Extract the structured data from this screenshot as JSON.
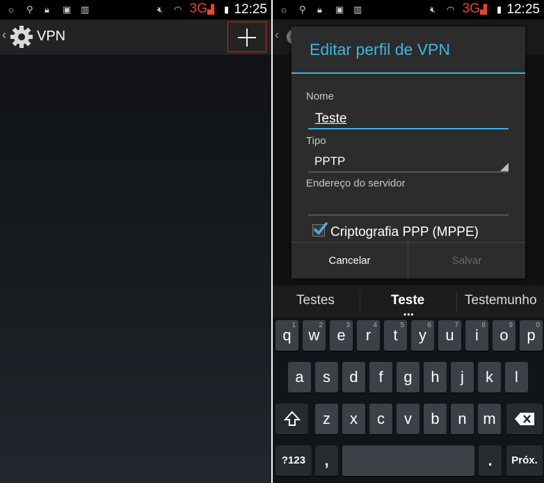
{
  "status": {
    "time": "12:25",
    "network": "3G"
  },
  "left": {
    "actionbar": {
      "title": "VPN"
    }
  },
  "dialog": {
    "title": "Editar perfil de VPN",
    "name_label": "Nome",
    "name_value": "Teste",
    "type_label": "Tipo",
    "type_value": "PPTP",
    "server_label": "Endereço do servidor",
    "server_value": "",
    "checkbox_label": "Criptografia PPP (MPPE)",
    "checkbox_checked": true,
    "cancel_label": "Cancelar",
    "save_label": "Salvar"
  },
  "keyboard": {
    "suggestions": [
      "Testes",
      "Teste",
      "Testemunho"
    ],
    "row1": [
      {
        "k": "q",
        "n": "1"
      },
      {
        "k": "w",
        "n": "2"
      },
      {
        "k": "e",
        "n": "3"
      },
      {
        "k": "r",
        "n": "4"
      },
      {
        "k": "t",
        "n": "5"
      },
      {
        "k": "y",
        "n": "6"
      },
      {
        "k": "u",
        "n": "7"
      },
      {
        "k": "i",
        "n": "8"
      },
      {
        "k": "o",
        "n": "9"
      },
      {
        "k": "p",
        "n": "0"
      }
    ],
    "row2": [
      "a",
      "s",
      "d",
      "f",
      "g",
      "h",
      "j",
      "k",
      "l"
    ],
    "row3": [
      "z",
      "x",
      "c",
      "v",
      "b",
      "n",
      "m"
    ],
    "symbols_label": "?123",
    "comma_label": ",",
    "period_label": ".",
    "next_label": "Próx."
  },
  "colors": {
    "accent": "#3bb6e6",
    "highlight": "#e02020",
    "network": "#e8462c"
  }
}
